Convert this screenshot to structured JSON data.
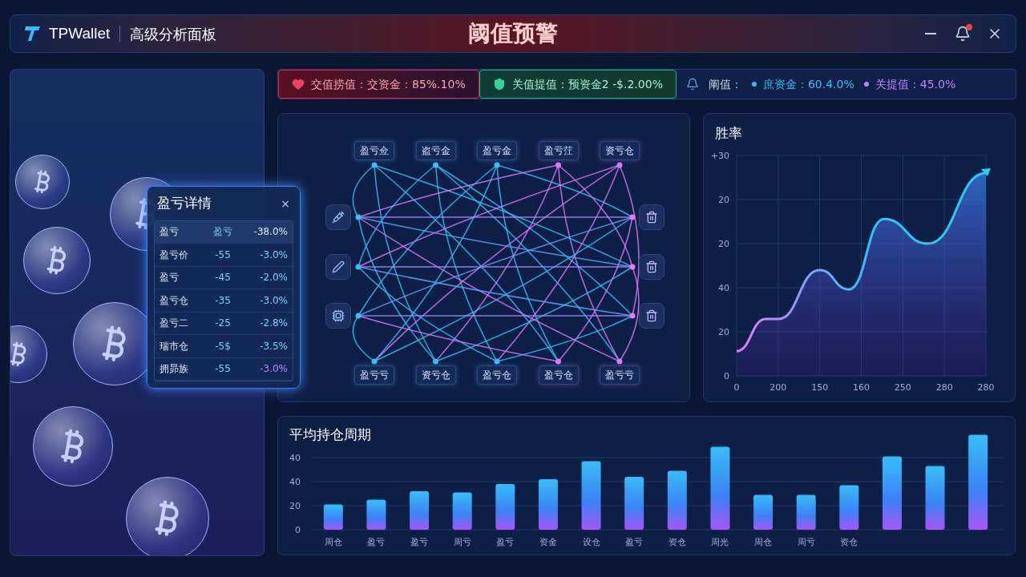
{
  "header": {
    "brand": "TPWallet",
    "subtitle": "高级分析面板",
    "title": "阈值预警",
    "notification_badge": true
  },
  "alerts": [
    {
      "kind": "danger",
      "text": "交值捞值：交资金：85%.10%"
    },
    {
      "kind": "success",
      "text": "关值提值：预资金2 -$.2.00%"
    },
    {
      "kind": "info",
      "text": "阐值：",
      "items": [
        {
          "text": "庶资金：60.4.0%",
          "color": "#38bdf8"
        },
        {
          "text": "关提值：45.0%",
          "color": "#c084fc"
        }
      ]
    }
  ],
  "detail": {
    "title": "盈亏详情",
    "close": "×",
    "rows": [
      {
        "label": "盈亏",
        "value": "盈亏",
        "pct": "-38.0%",
        "color": "#e2e8f0"
      },
      {
        "label": "盈亏价",
        "value": "-55",
        "pct": "-3.0%",
        "color": "#7dd3fc"
      },
      {
        "label": "盈亏",
        "value": "-45",
        "pct": "-2.0%",
        "color": "#7dd3fc"
      },
      {
        "label": "盈亏仓",
        "value": "-35",
        "pct": "-3.0%",
        "color": "#7dd3fc"
      },
      {
        "label": "盈亏二",
        "value": "-25",
        "pct": "-2.8%",
        "color": "#7dd3fc"
      },
      {
        "label": "瑞市仓",
        "value": "-5$",
        "pct": "-3.5%",
        "color": "#7dd3fc"
      },
      {
        "label": "拥昴族",
        "value": "-55",
        "pct": "-3.0%",
        "color": "#c084fc"
      }
    ]
  },
  "network": {
    "top": [
      {
        "label": "盈亏佥",
        "color": "#38bdf8"
      },
      {
        "label": "盗亏金",
        "color": "#38bdf8"
      },
      {
        "label": "盈亏金",
        "color": "#38bdf8"
      },
      {
        "label": "盈亏茳",
        "color": "#d878f8"
      },
      {
        "label": "资亏仓",
        "color": "#d878f8"
      }
    ],
    "bottom": [
      {
        "label": "盈亏亏",
        "color": "#38bdf8"
      },
      {
        "label": "资亏仓",
        "color": "#38bdf8"
      },
      {
        "label": "盈亏仓",
        "color": "#38bdf8"
      },
      {
        "label": "盈亏仓",
        "color": "#d878f8"
      },
      {
        "label": "盈亏亏",
        "color": "#d878f8"
      }
    ]
  },
  "win_rate": {
    "title": "胜率",
    "y_labels": [
      "+30",
      "20",
      "20",
      "40",
      "20",
      "0"
    ],
    "x_labels": [
      "0",
      "200",
      "150",
      "160",
      "250",
      "280",
      "280"
    ]
  },
  "holding": {
    "title": "平均持仓周期",
    "chart_data": {
      "type": "bar",
      "categories": [
        "周仓",
        "盈亏",
        "盈亏",
        "周亏",
        "盈亏",
        "资金",
        "设仓",
        "盈亏",
        "资仓",
        "周光",
        "周仓",
        "周亏",
        "资仓",
        null,
        null,
        null
      ],
      "series": [
        {
          "color": "#38bdf8",
          "values": [
            21,
            25,
            32,
            31,
            38,
            42,
            57,
            44,
            49,
            69,
            29,
            29,
            37,
            61,
            53,
            79
          ]
        }
      ],
      "ylim": [
        0,
        80
      ],
      "grid": true,
      "yticks": [
        0,
        20,
        40
      ]
    },
    "top_tick_label": "40"
  }
}
